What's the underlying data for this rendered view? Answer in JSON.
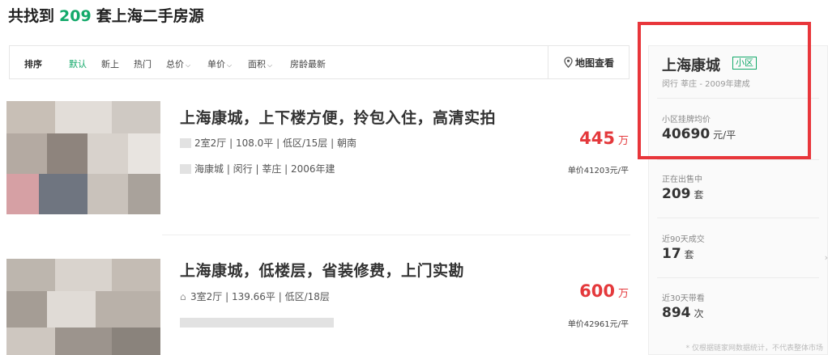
{
  "header": {
    "prefix": "共找到",
    "count": "209",
    "suffix": "套上海二手房源"
  },
  "sortbar": {
    "items": [
      {
        "label": "排序"
      },
      {
        "label": "默认"
      },
      {
        "label": "新上"
      },
      {
        "label": "热门"
      },
      {
        "label": "总价"
      },
      {
        "label": "单价"
      },
      {
        "label": "面积"
      },
      {
        "label": "房龄最新"
      }
    ],
    "map_link": "地图查看"
  },
  "listings": [
    {
      "title": "上海康城，上下楼方便，拎包入住，高清实拍",
      "info": "2室2厅 | 108.0平 | 低区/15层 | 朝南",
      "location": "海康城 | 闵行 | 莘庄 | 2006年建",
      "price": "445",
      "price_unit": "万",
      "unit_price": "单价41203元/平"
    },
    {
      "title": "上海康城，低楼层，省装修费，上门实勘",
      "info": "3室2厅 | 139.66平 | 低区/18层",
      "location": "",
      "price": "600",
      "price_unit": "万",
      "unit_price": "单价42961元/平"
    }
  ],
  "panel": {
    "name": "上海康城",
    "tag": "小区",
    "sub": "闵行 莘庄 - 2009年建成",
    "avg_label": "小区挂牌均价",
    "avg_value": "40690",
    "avg_unit": "元/平",
    "on_sale_label": "正在出售中",
    "on_sale_value": "209",
    "on_sale_unit": "套",
    "deals_label": "近90天成交",
    "deals_value": "17",
    "deals_unit": "套",
    "visits_label": "近30天带看",
    "visits_value": "894",
    "visits_unit": "次",
    "footnote": "* 仅根据链家网数据统计，不代表整体市场"
  },
  "colors": {
    "accent_green": "#13a96a",
    "price_red": "#e4393c",
    "highlight_red": "#e8363b"
  }
}
